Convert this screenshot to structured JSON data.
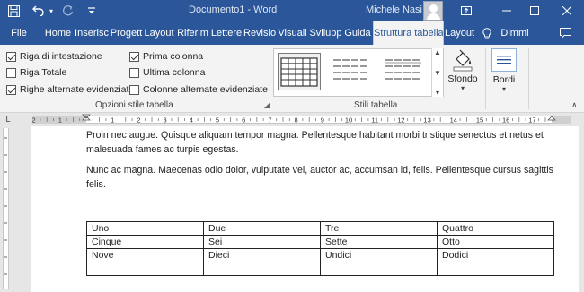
{
  "titlebar": {
    "title": "Documento1 - Word",
    "user": "Michele Nasi",
    "icons": [
      "save-icon",
      "undo-icon",
      "redo-icon",
      "customize-icon"
    ]
  },
  "tabs": [
    {
      "label": "File",
      "active": false
    },
    {
      "label": "Home",
      "active": false
    },
    {
      "label": "Inserisc",
      "active": false
    },
    {
      "label": "Progett",
      "active": false
    },
    {
      "label": "Layout",
      "active": false
    },
    {
      "label": "Riferim",
      "active": false
    },
    {
      "label": "Lettere",
      "active": false
    },
    {
      "label": "Revisio",
      "active": false
    },
    {
      "label": "Visuali",
      "active": false
    },
    {
      "label": "Svilupp",
      "active": false
    },
    {
      "label": "Guida",
      "active": false
    },
    {
      "label": "Struttura tabella",
      "active": true
    },
    {
      "label": "Layout",
      "active": false
    }
  ],
  "tell_me": "Dimmi",
  "ribbon": {
    "options": [
      {
        "label": "Riga di intestazione",
        "checked": true
      },
      {
        "label": "Riga Totale",
        "checked": false
      },
      {
        "label": "Righe alternate evidenziate",
        "checked": true
      },
      {
        "label": "Prima colonna",
        "checked": true
      },
      {
        "label": "Ultima colonna",
        "checked": false
      },
      {
        "label": "Colonne alternate evidenziate",
        "checked": false
      }
    ],
    "options_group_label": "Opzioni stile tabella",
    "styles_group_label": "Stili tabella",
    "shading_label": "Sfondo",
    "borders_label": "Bordi"
  },
  "document": {
    "para1": "Proin nec augue. Quisque aliquam tempor magna. Pellentesque habitant morbi tristique senectus et netus et malesuada fames ac turpis egestas.",
    "para2": "Nunc ac magna. Maecenas odio dolor, vulputate vel, auctor ac, accumsan id, felis. Pellentesque cursus sagittis felis.",
    "table": [
      [
        "Uno",
        "Due",
        "Tre",
        "Quattro"
      ],
      [
        "Cinque",
        "Sei",
        "Sette",
        "Otto"
      ],
      [
        "Nove",
        "Dieci",
        "Undici",
        "Dodici"
      ],
      [
        "",
        "",
        "",
        ""
      ]
    ]
  },
  "ruler_numbers": [
    "2",
    "1",
    "1",
    "2",
    "3",
    "4",
    "5",
    "6",
    "7",
    "8",
    "9",
    "10",
    "11",
    "12",
    "13",
    "14",
    "15",
    "16",
    "17"
  ],
  "colors": {
    "accent": "#2b579a",
    "ribbon": "#f3f3f3",
    "canvas": "#e6e6e6"
  }
}
